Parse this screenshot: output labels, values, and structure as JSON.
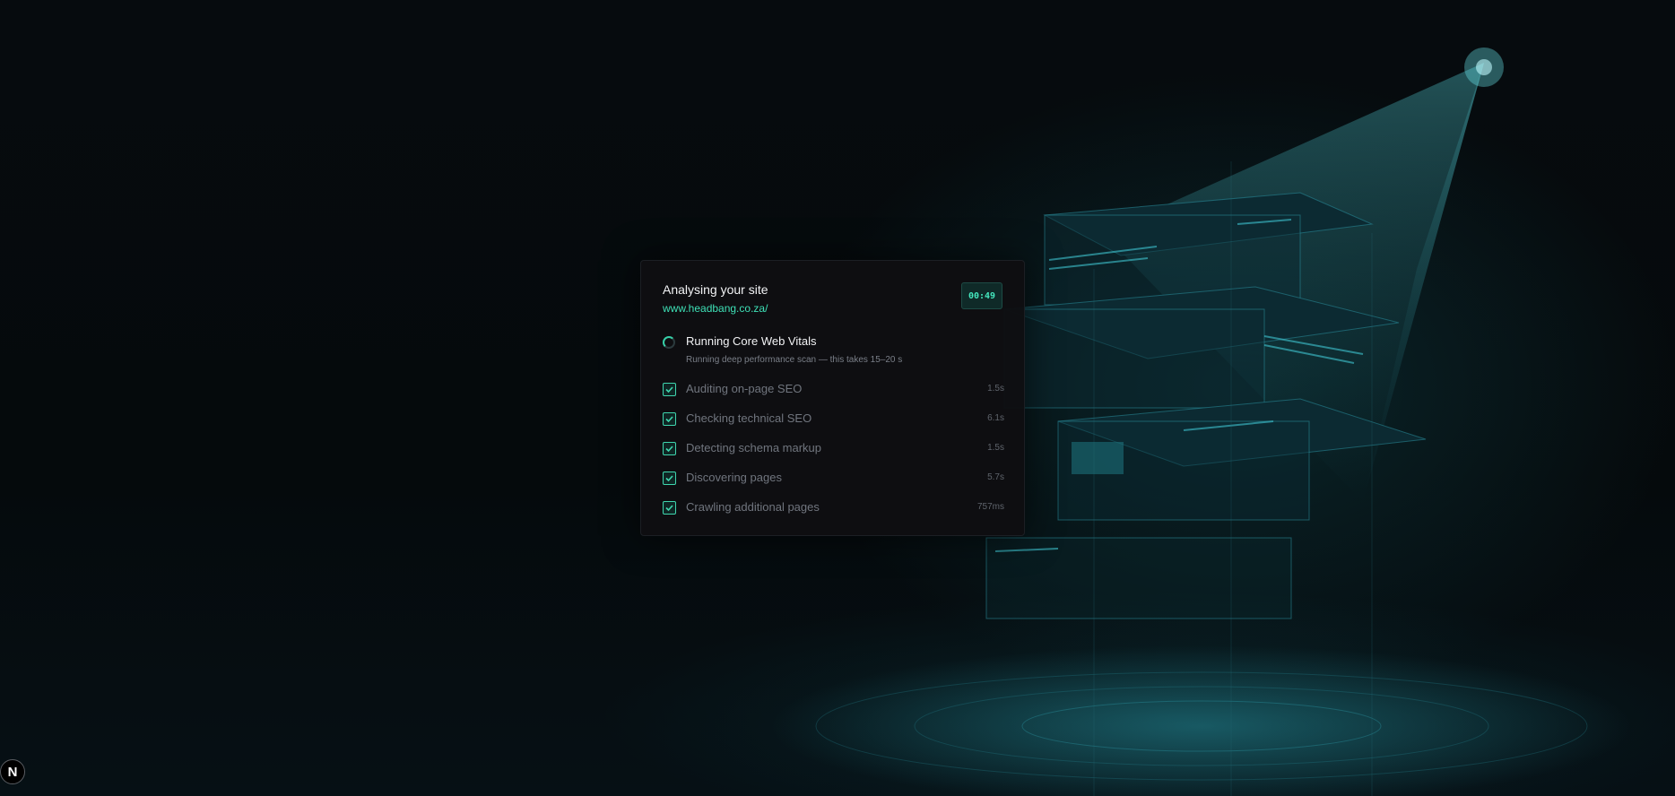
{
  "card": {
    "title": "Analysing your site",
    "url": "www.headbang.co.za/",
    "timer": "00:49"
  },
  "current_step": {
    "label": "Running Core Web Vitals",
    "subtitle": "Running deep performance scan — this takes 15–20 s",
    "icon": "spinner-icon"
  },
  "completed_steps": [
    {
      "label": "Auditing on-page SEO",
      "time": "1.5s"
    },
    {
      "label": "Checking technical SEO",
      "time": "6.1s"
    },
    {
      "label": "Detecting schema markup",
      "time": "1.5s"
    },
    {
      "label": "Discovering pages",
      "time": "5.7s"
    },
    {
      "label": "Crawling additional pages",
      "time": "757ms"
    }
  ],
  "badge": {
    "letter": "N"
  },
  "colors": {
    "accent": "#3ee0b6",
    "card_bg": "#0e0e12",
    "page_bg": "#050a0d"
  }
}
